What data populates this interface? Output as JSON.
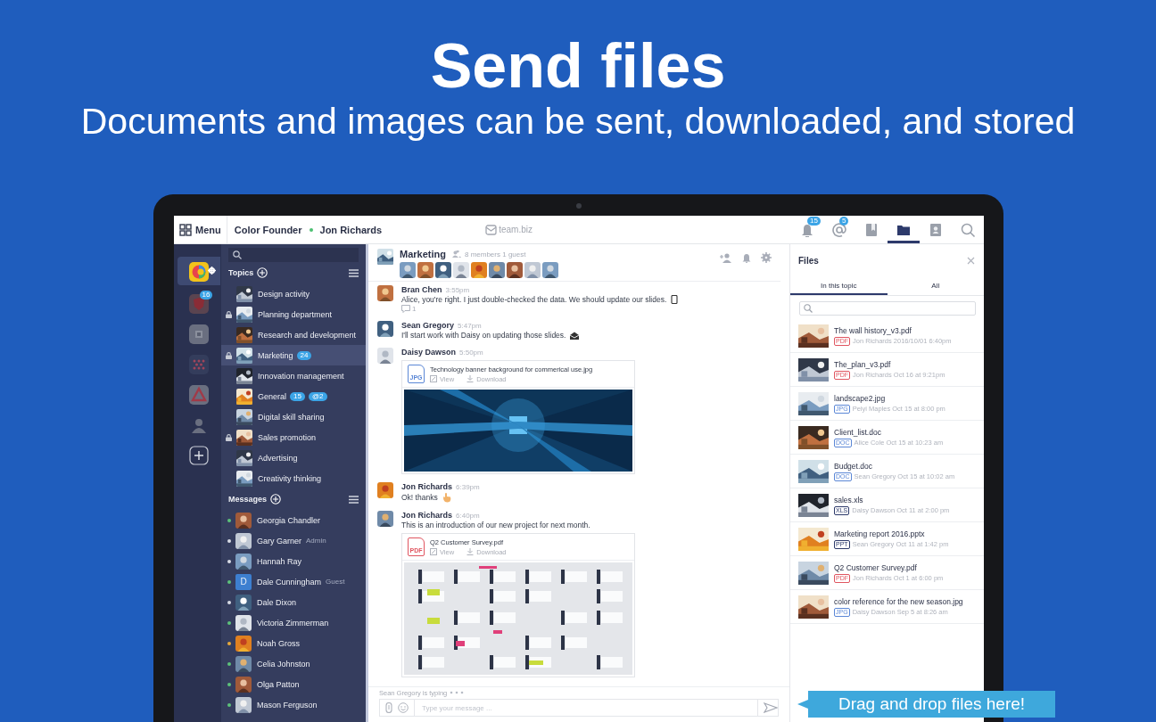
{
  "headline": {
    "title": "Send files",
    "subtitle": "Documents and images can be sent, downloaded, and stored"
  },
  "topbar": {
    "menu": "Menu",
    "workspace": "Color Founder",
    "user": "Jon Richards",
    "logo": "team.biz",
    "icons": [
      {
        "kind": "bell",
        "badge": "15",
        "selected": false
      },
      {
        "kind": "mention",
        "badge": "5",
        "selected": false
      },
      {
        "kind": "bookmark",
        "selected": false
      },
      {
        "kind": "folder",
        "selected": true
      },
      {
        "kind": "contact",
        "selected": false
      },
      {
        "kind": "search",
        "selected": false
      }
    ]
  },
  "rail": {
    "items": [
      {
        "kind": "logo",
        "selected": true
      },
      {
        "kind": "shield",
        "badge": "16",
        "selected": false
      },
      {
        "kind": "grid",
        "selected": false
      },
      {
        "kind": "dots",
        "selected": false
      },
      {
        "kind": "triangle",
        "selected": false
      },
      {
        "kind": "person",
        "selected": false
      },
      {
        "kind": "add",
        "selected": false
      }
    ]
  },
  "sidebar": {
    "topics": {
      "title": "Topics",
      "items": [
        {
          "name": "Design activity",
          "locked": false,
          "selected": false
        },
        {
          "name": "Planning department",
          "locked": true,
          "selected": false
        },
        {
          "name": "Research and development",
          "locked": false,
          "selected": false
        },
        {
          "name": "Marketing",
          "locked": true,
          "selected": true,
          "badges": [
            "24"
          ]
        },
        {
          "name": "Innovation management",
          "locked": false,
          "selected": false
        },
        {
          "name": "General",
          "locked": false,
          "selected": false,
          "badges": [
            "15",
            "@2"
          ]
        },
        {
          "name": "Digital skill sharing",
          "locked": false,
          "selected": false
        },
        {
          "name": "Sales promotion",
          "locked": true,
          "selected": false
        },
        {
          "name": "Advertising",
          "locked": false,
          "selected": false
        },
        {
          "name": "Creativity thinking",
          "locked": false,
          "selected": false
        }
      ]
    },
    "messages": {
      "title": "Messages",
      "items": [
        {
          "name": "Georgia Chandler",
          "color": "#5cc27a"
        },
        {
          "name": "Gary Garner",
          "role": "Admin",
          "color": "#d8dce6"
        },
        {
          "name": "Hannah Ray",
          "color": "#d8dce6"
        },
        {
          "name": "Dale Cunningham",
          "role": "Guest",
          "color": "#5cc27a",
          "initial": "D"
        },
        {
          "name": "Dale Dixon",
          "color": "#d8dce6"
        },
        {
          "name": "Victoria Zimmerman",
          "color": "#5cc27a"
        },
        {
          "name": "Noah Gross",
          "color": "#e8a93a"
        },
        {
          "name": "Celia Johnston",
          "color": "#5cc27a"
        },
        {
          "name": "Olga Patton",
          "color": "#5cc27a"
        },
        {
          "name": "Mason Ferguson",
          "color": "#5cc27a"
        }
      ]
    }
  },
  "chat": {
    "topic": "Marketing",
    "members": "8 members 1 guest",
    "messages": [
      {
        "author": "Bran Chen",
        "time": "3:55pm",
        "text": "Alice, you're right. I just double-checked the data. We should update our slides.",
        "trailing": {
          "kind": "phone"
        },
        "replies": "1"
      },
      {
        "author": "Sean Gregory",
        "time": "5:47pm",
        "text": "I'll start work with Daisy on updating those slides.",
        "trailing": {
          "kind": "envelope"
        }
      },
      {
        "author": "Daisy Dawson",
        "time": "5:50pm",
        "attachment": {
          "name": "Technology banner background for commerical use.jpg",
          "tag": "JPG",
          "view": "View",
          "download": "Download"
        }
      },
      {
        "author": "Jon Richards",
        "time": "6:39pm",
        "text": "Ok! thanks",
        "trailing": {
          "kind": "hand"
        }
      },
      {
        "author": "Jon Richards",
        "time": "6:40pm",
        "text": "This is an introduction of our new project for next month.",
        "attachment": {
          "name": "Q2 Customer Survey.pdf",
          "tag": "PDF",
          "kind": "document",
          "view": "View",
          "download": "Download"
        }
      }
    ],
    "typing": "Sean Gregory is typing",
    "composer_placeholder": "Type your message ..."
  },
  "files": {
    "title": "Files",
    "tabs": [
      {
        "label": "In this topic",
        "selected": true
      },
      {
        "label": "All",
        "selected": false
      }
    ],
    "items": [
      {
        "name": "The wall history_v3.pdf",
        "tag": "PDF",
        "kind": "pdf",
        "meta": "Jon Richards 2016/10/01 6:40pm"
      },
      {
        "name": "The_plan_v3.pdf",
        "tag": "PDF",
        "kind": "pdf",
        "meta": "Jon Richards Oct 16 at 9:21pm"
      },
      {
        "name": "landscape2.jpg",
        "tag": "JPG",
        "meta": "Peiyi Maples Oct 15 at 8:00 pm"
      },
      {
        "name": "Client_list.doc",
        "tag": "DOC",
        "kind": "doc",
        "meta": "Alice Cole Oct 15 at 10:23 am"
      },
      {
        "name": "Budget.doc",
        "tag": "DOC",
        "kind": "doc",
        "meta": "Sean Gregory Oct 15 at 10:02 am"
      },
      {
        "name": "sales.xls",
        "tag": "XLS",
        "kind": "sheet",
        "meta": "Daisy Dawson Oct 11 at 2:00 pm"
      },
      {
        "name": "Marketing report 2016.pptx",
        "tag": "PPT",
        "kind": "slides",
        "meta": "Sean Gregory Oct 11 at 1:42 pm"
      },
      {
        "name": "Q2 Customer Survey.pdf",
        "tag": "PDF",
        "kind": "pdf",
        "meta": "Jon Richards Oct 1 at 6:00 pm"
      },
      {
        "name": "color reference for the new season.jpg",
        "tag": "JPG",
        "meta": "Daisy Dawson Sep 5 at 8:26 am"
      }
    ]
  },
  "callout": "Drag and drop files here!"
}
